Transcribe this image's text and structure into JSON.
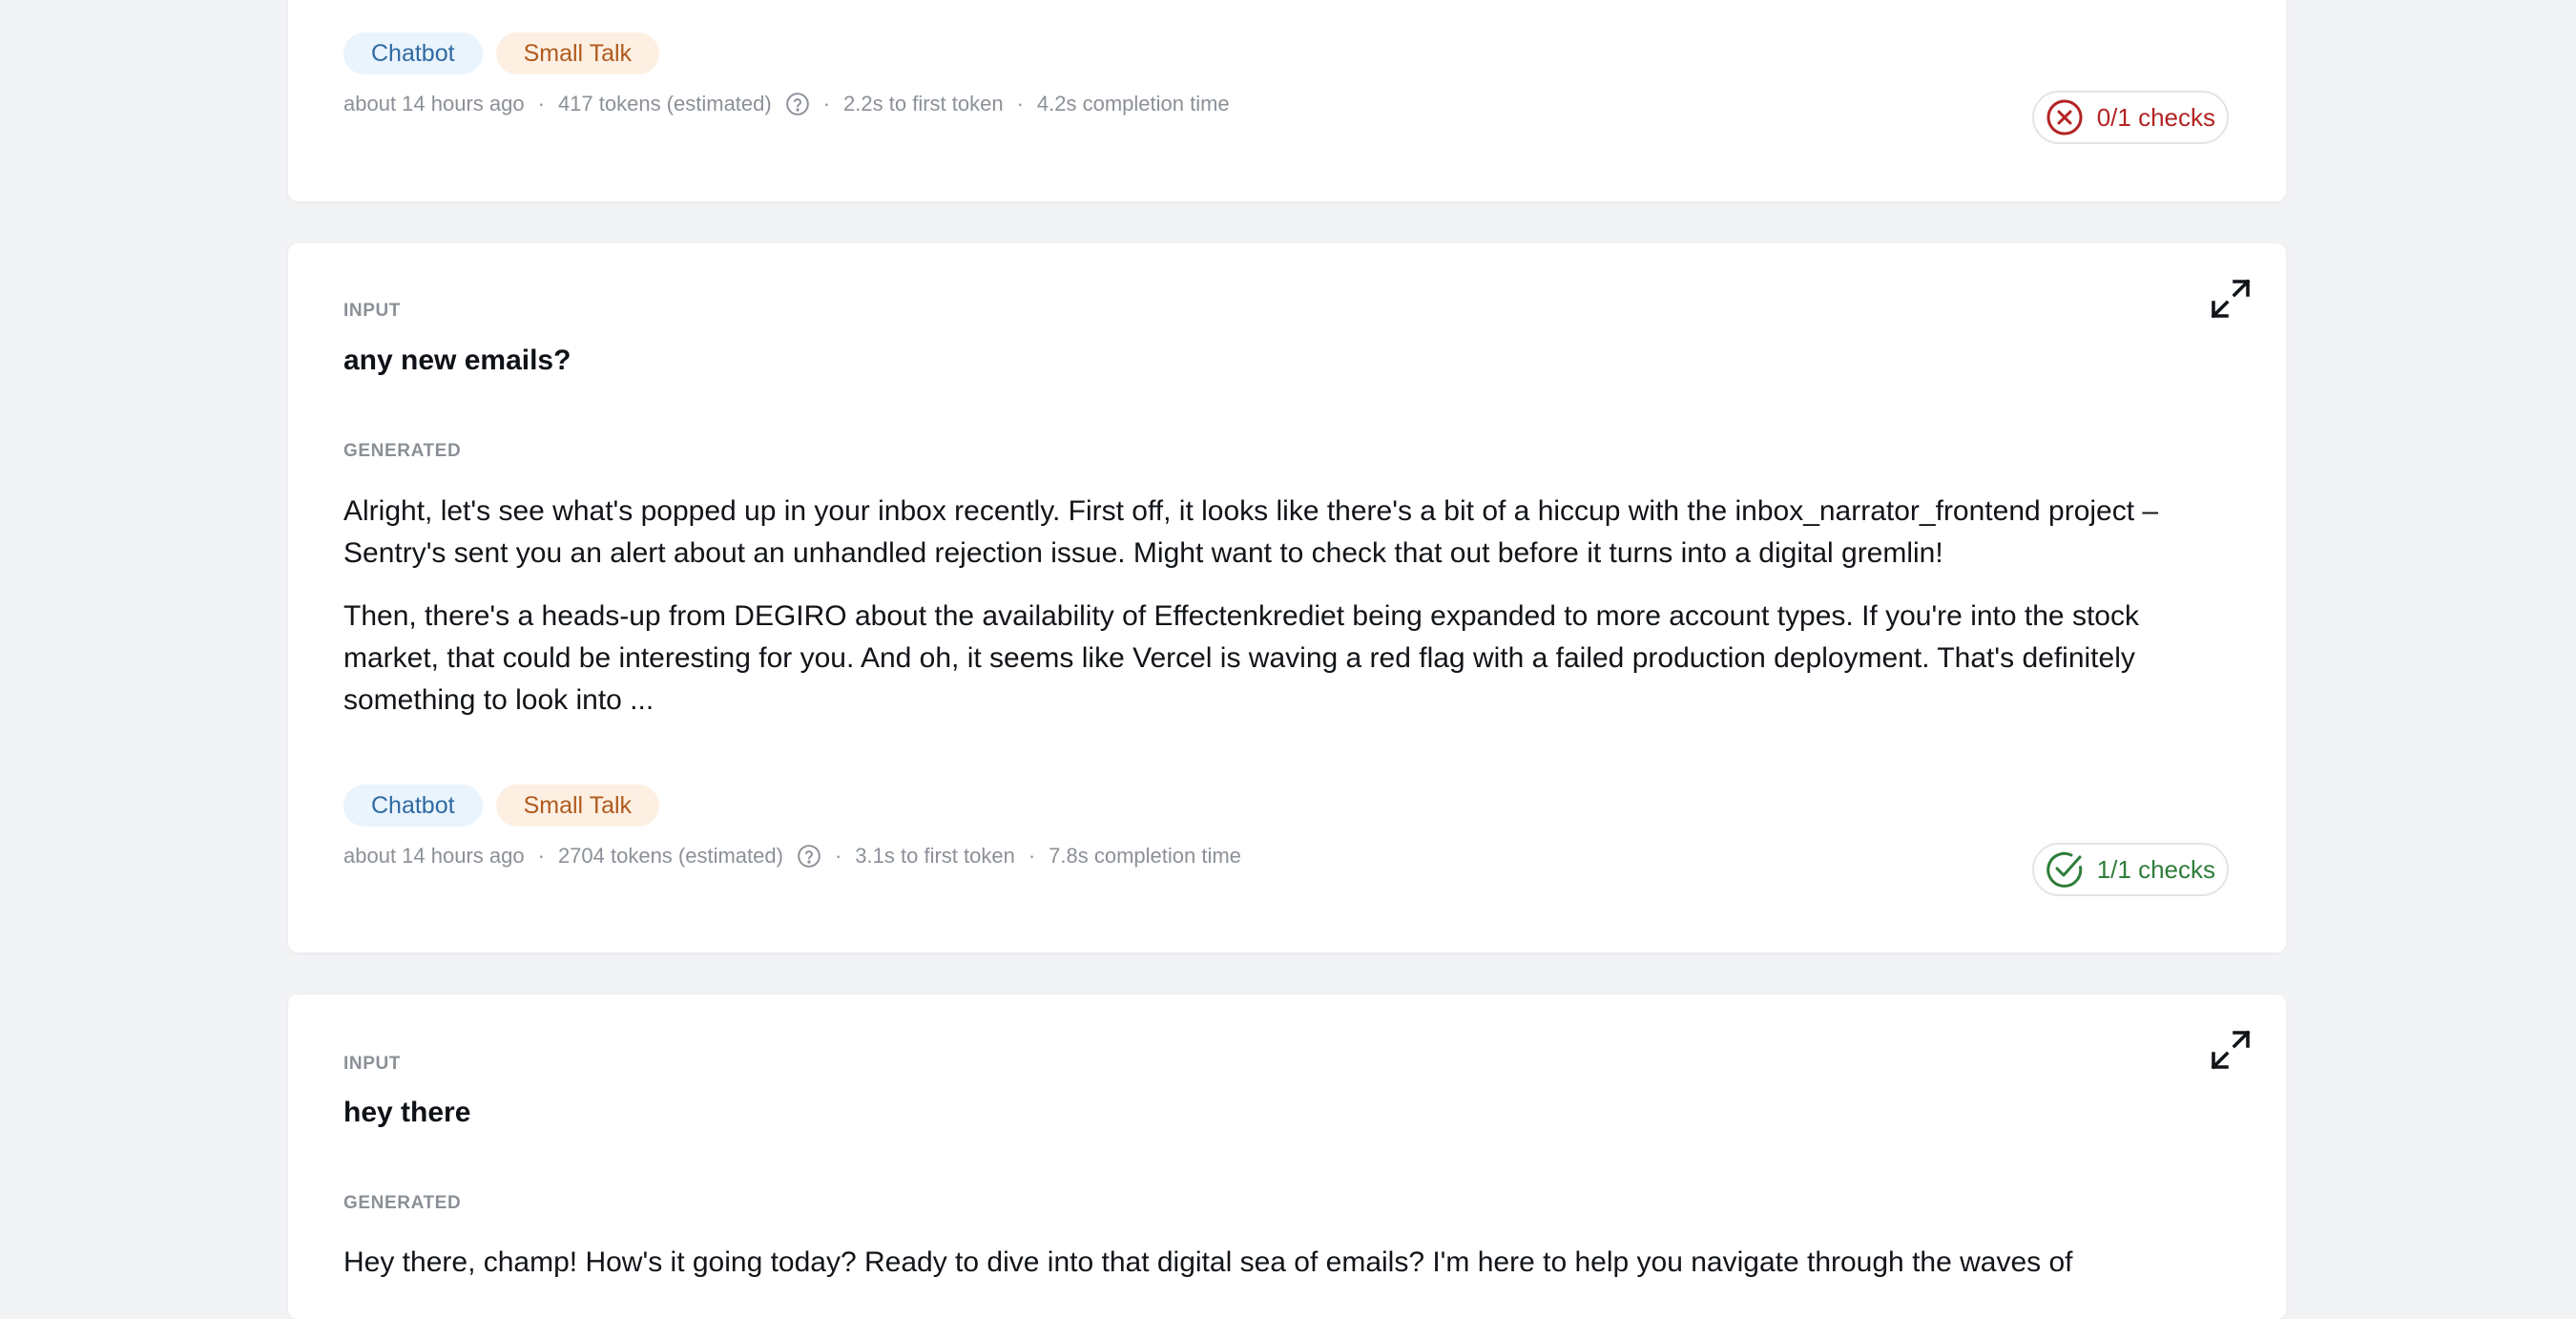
{
  "entries": [
    {
      "tags": [
        "Chatbot",
        "Small Talk"
      ],
      "meta": {
        "time": "about 14 hours ago",
        "tokens": "417 tokens (estimated)",
        "first_token": "2.2s to first token",
        "completion": "4.2s completion time"
      },
      "checks": "0/1 checks",
      "checks_status": "fail"
    },
    {
      "input_label": "INPUT",
      "input": "any new emails?",
      "generated_label": "GENERATED",
      "generated": [
        "Alright, let's see what's popped up in your inbox recently. First off, it looks like there's a bit of a hiccup with the inbox_narrator_frontend project – Sentry's sent you an alert about an unhandled rejection issue. Might want to check that out before it turns into a digital gremlin!",
        "Then, there's a heads-up from DEGIRO about the availability of Effectenkrediet being expanded to more account types. If you're into the stock market, that could be interesting for you. And oh, it seems like Vercel is waving a red flag with a failed production deployment. That's definitely something to look into ..."
      ],
      "tags": [
        "Chatbot",
        "Small Talk"
      ],
      "meta": {
        "time": "about 14 hours ago",
        "tokens": "2704 tokens (estimated)",
        "first_token": "3.1s to first token",
        "completion": "7.8s completion time"
      },
      "checks": "1/1 checks",
      "checks_status": "pass"
    },
    {
      "input_label": "INPUT",
      "input": "hey there",
      "generated_label": "GENERATED",
      "generated": [
        "Hey there, champ! How's it going today? Ready to dive into that digital sea of emails? I'm here to help you navigate through the waves of"
      ]
    }
  ],
  "separator": "·",
  "icons": {
    "expand": "expand-icon",
    "help": "help-circle-icon",
    "fail": "x-circle-icon",
    "pass": "check-circle-icon"
  },
  "colors": {
    "fail": "#b42323",
    "pass": "#2e7d3a",
    "tag_blue_bg": "#eaf4fd",
    "tag_orange_bg": "#fdf0e3"
  }
}
